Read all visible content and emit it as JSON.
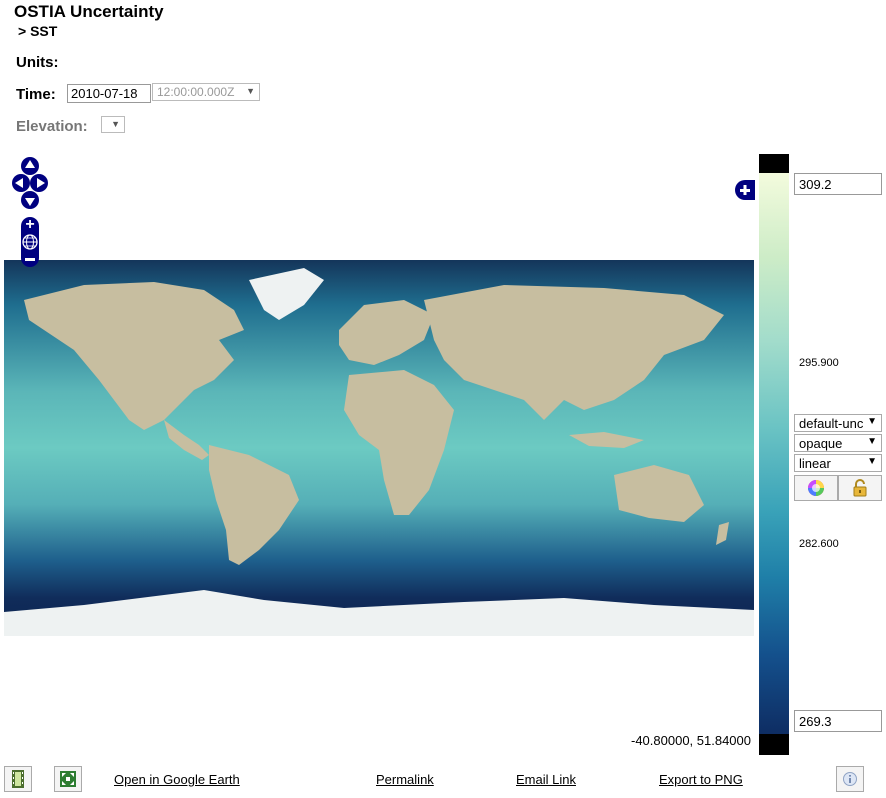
{
  "header": {
    "title": "OSTIA Uncertainty",
    "subtitle": "> SST"
  },
  "units": {
    "label": "Units:"
  },
  "time": {
    "label": "Time:",
    "date_value": "2010-07-18",
    "time_value": "12:00:00.000Z"
  },
  "elevation": {
    "label": "Elevation:",
    "value": ""
  },
  "map": {
    "ocean_color": "#1a5a86",
    "land_color": "#c9c2a3",
    "ice_color": "#eef2f2",
    "coordinates_readout": "-40.80000, 51.84000"
  },
  "colorbar": {
    "max_value": "309.2",
    "mid_high_label": "295.900",
    "mid_low_label": "282.600",
    "min_value": "269.3",
    "palette": "default-unc",
    "opacity": "opaque",
    "scale": "linear",
    "out_of_range_color": "#000000"
  },
  "icons": {
    "pan": "pan-arrows-icon",
    "zoom_in": "zoom-in-icon",
    "zoom_world": "globe-icon",
    "zoom_out": "zoom-out-icon",
    "layer_switcher": "plus-icon",
    "palette": "color-wheel-icon",
    "lock": "lock-icon",
    "animation": "film-icon",
    "fullscreen": "expand-icon",
    "info": "info-icon"
  },
  "footer": {
    "google_earth": "Open in Google Earth",
    "permalink": "Permalink",
    "email": "Email Link",
    "export": "Export to PNG"
  }
}
